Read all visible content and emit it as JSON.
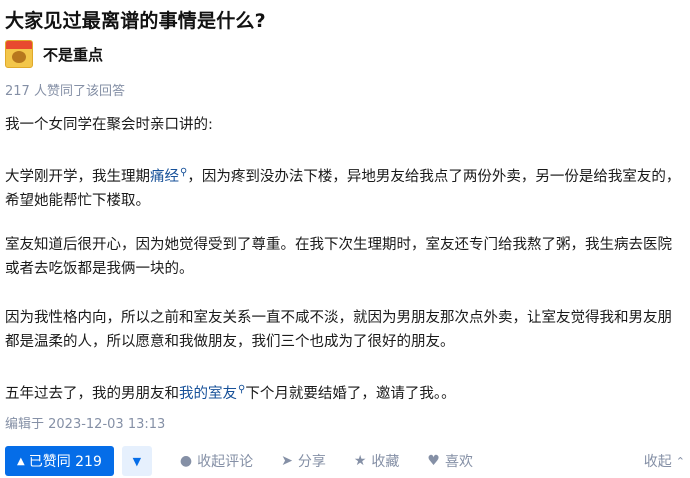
{
  "question": {
    "title": "大家见过最离谱的事情是什么?"
  },
  "author": {
    "name": "不是重点"
  },
  "votes_text": "217 人赞同了该回答",
  "paragraphs": {
    "p1": "我一个女同学在聚会时亲口讲的:",
    "p2a": "大学刚开学，我生理期",
    "p2link": "痛经",
    "p2b": "，因为疼到没办法下楼，异地男友给我点了两份外卖，另一份是给我室友的，希望她能帮忙下楼取。",
    "p3": "室友知道后很开心，因为她觉得受到了尊重。在我下次生理期时，室友还专门给我熬了粥，我生病去医院或者去吃饭都是我俩一块的。",
    "p4": "因为我性格内向，所以之前和室友关系一直不咸不淡，就因为男朋友那次点外卖，让室友觉得我和男友朋都是温柔的人，所以愿意和我做朋友，我们三个也成为了很好的朋友。",
    "p5a": "五年过去了，我的男朋友和",
    "p5link": "我的室友",
    "p5b": "下个月就要结婚了，邀请了我。。"
  },
  "edited": "编辑于 2023-12-03 13:13",
  "actions": {
    "upvote": "已赞同 219",
    "comment": "收起评论",
    "share": "分享",
    "favorite": "收藏",
    "like": "喜欢",
    "collapse": "收起"
  },
  "icons": {
    "upvote": "triangle-up-icon",
    "downvote": "triangle-down-icon",
    "comment": "comment-bubble-icon",
    "share": "paper-plane-icon",
    "favorite": "star-icon",
    "like": "heart-icon",
    "collapse": "chevron-up-icon",
    "search": "search-icon"
  },
  "colors": {
    "accent": "#056de8",
    "link": "#175199",
    "meta": "#8590a6"
  }
}
